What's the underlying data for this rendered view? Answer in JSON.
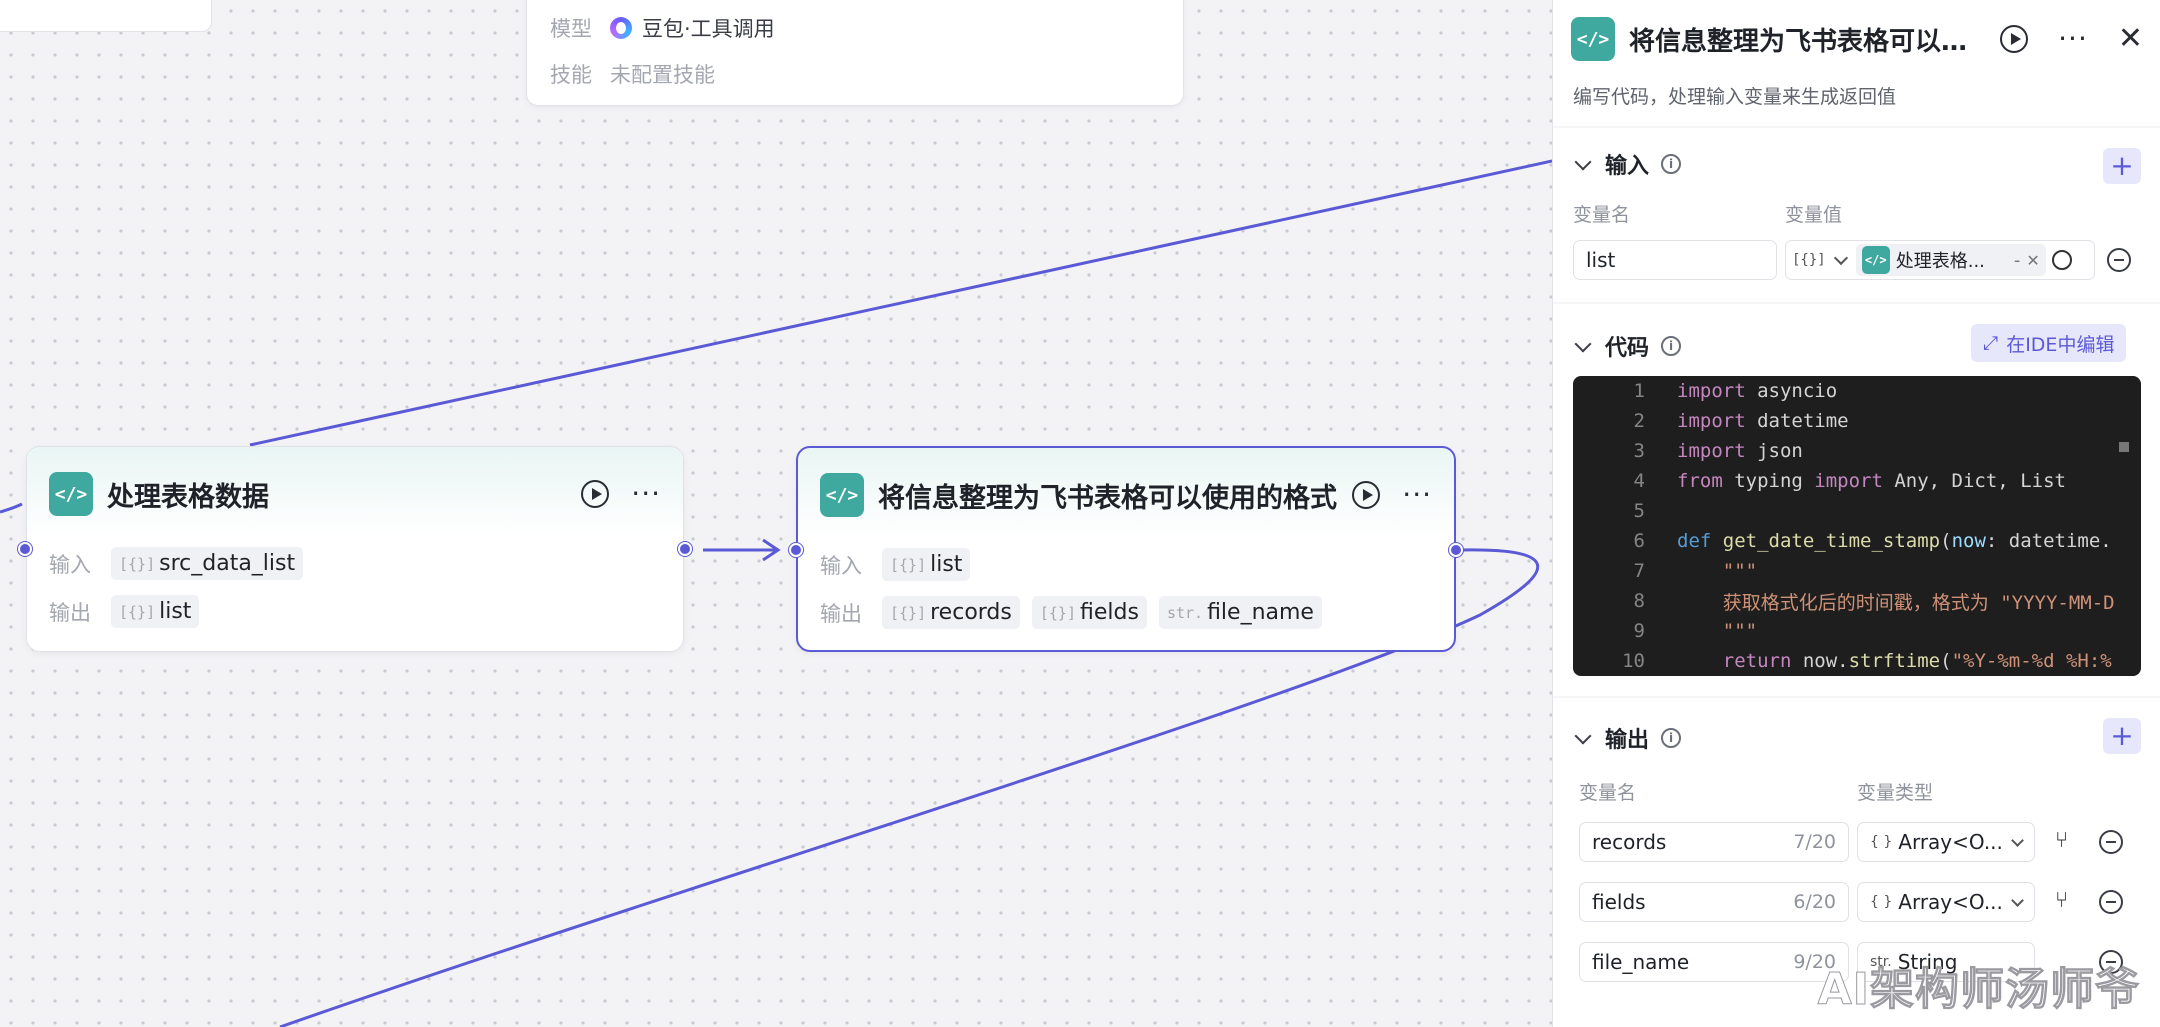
{
  "agent_card": {
    "model_label": "模型",
    "model_value": "豆包·工具调用",
    "skill_label": "技能",
    "skill_value": "未配置技能"
  },
  "nodes": [
    {
      "title": "处理表格数据",
      "input_label": "输入",
      "output_label": "输出",
      "inputs": [
        {
          "type": "[{}]",
          "name": "src_data_list"
        }
      ],
      "outputs": [
        {
          "type": "[{}]",
          "name": "list"
        }
      ]
    },
    {
      "title": "将信息整理为飞书表格可以使用的格式",
      "input_label": "输入",
      "output_label": "输出",
      "inputs": [
        {
          "type": "[{}]",
          "name": "list"
        }
      ],
      "outputs": [
        {
          "type": "[{}]",
          "name": "records"
        },
        {
          "type": "[{}]",
          "name": "fields"
        },
        {
          "type": "str.",
          "name": "file_name"
        }
      ]
    }
  ],
  "panel": {
    "title": "将信息整理为飞书表格可以使用的格式",
    "description": "编写代码，处理输入变量来生成返回值",
    "input_section": {
      "title": "输入",
      "col_name": "变量名",
      "col_value": "变量值",
      "var_name": "list",
      "type_tag": "[{}]",
      "ref_value": "处理表格数据 - list",
      "ref_display": "处理表格...",
      "ref_sep": "-"
    },
    "code_section": {
      "title": "代码",
      "ide_button": "在IDE中编辑",
      "lines": [
        "import asyncio",
        "import datetime",
        "import json",
        "from typing import Any, Dict, List",
        "",
        "def get_date_time_stamp(now: datetime.",
        "    \"\"\"",
        "    获取格式化后的时间戳，格式为 \"YYYY-MM-D",
        "    \"\"\"",
        "    return now.strftime(\"%Y-%m-%d %H:%"
      ]
    },
    "output_section": {
      "title": "输出",
      "col_name": "变量名",
      "col_type": "变量类型",
      "rows": [
        {
          "name": "records",
          "count": "7/20",
          "type": "Array<O..."
        },
        {
          "name": "fields",
          "count": "6/20",
          "type": "Array<O..."
        },
        {
          "name": "file_name",
          "count": "9/20",
          "type": "String"
        }
      ]
    }
  },
  "watermark": "AI架构师汤师爷",
  "colors": {
    "accent": "#5b5ad6",
    "code_icon": "#3fa9a0",
    "code_bg": "#1e1e1e"
  }
}
